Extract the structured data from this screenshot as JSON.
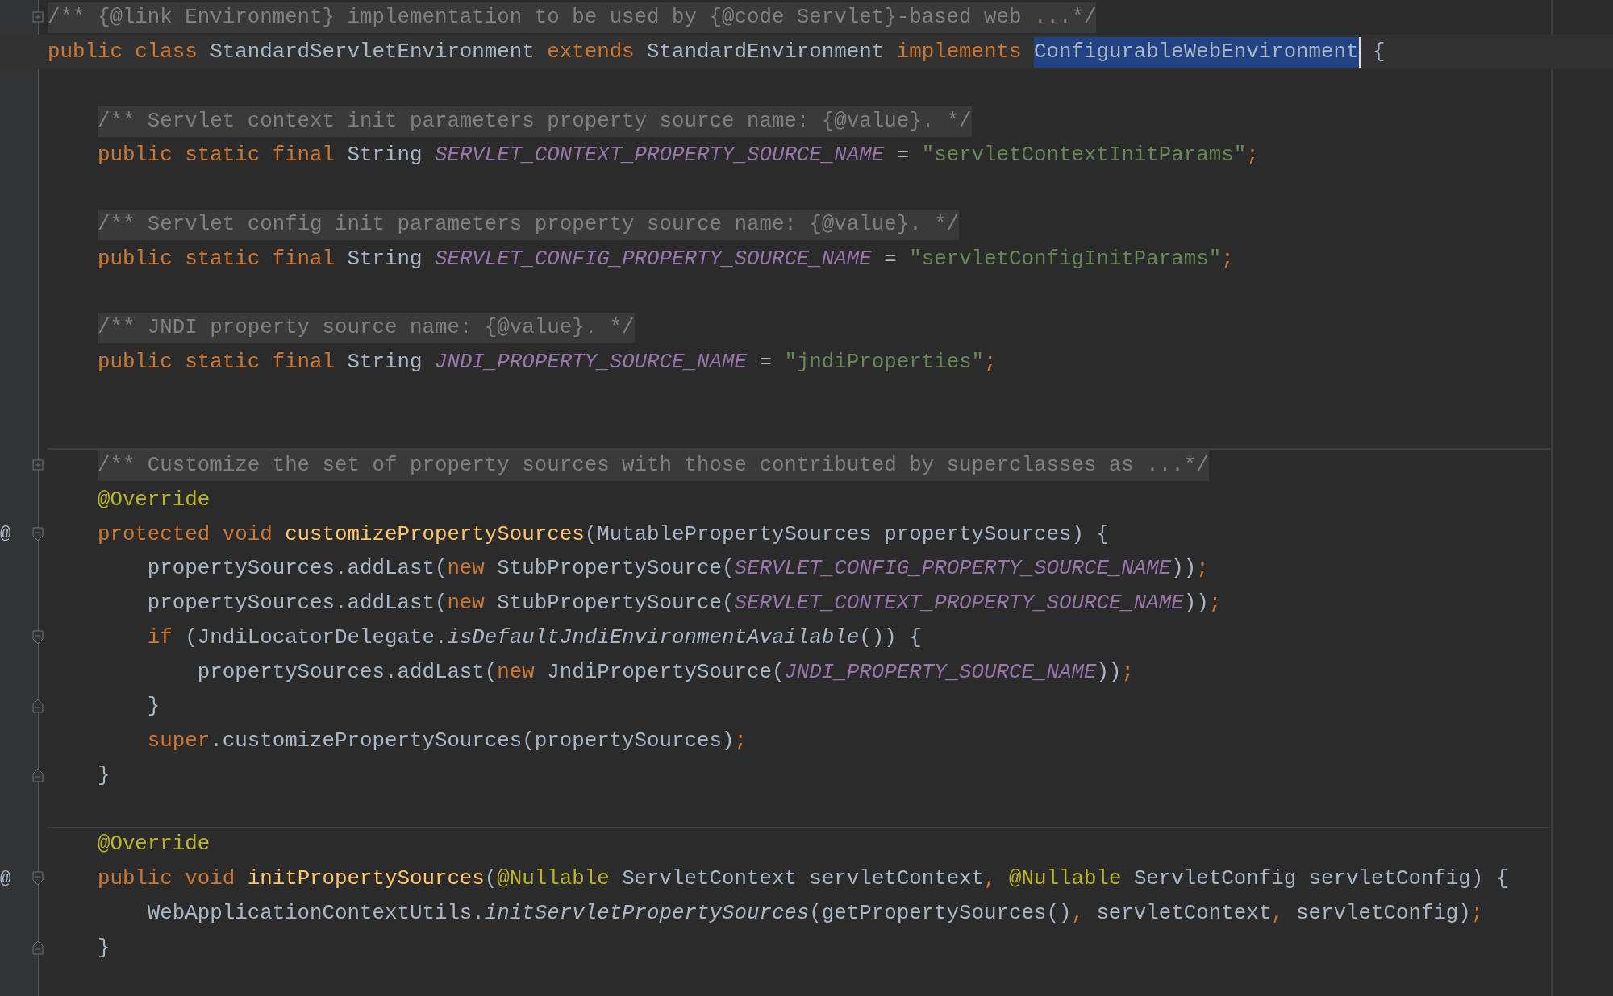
{
  "editor": {
    "lines": [
      {
        "kind": "code",
        "fold": {
          "kind": "expand"
        },
        "tokens": [
          {
            "kind": "folded-comment",
            "text": "/** {@link Environment} implementation to be used by {@code Servlet}-based web ...*/"
          }
        ]
      },
      {
        "kind": "code",
        "current": true,
        "tokens": [
          {
            "kind": "keyword",
            "text": "public class "
          },
          {
            "kind": "plain",
            "text": "StandardServletEnvironment "
          },
          {
            "kind": "keyword",
            "text": "extends "
          },
          {
            "kind": "plain",
            "text": "StandardEnvironment "
          },
          {
            "kind": "keyword",
            "text": "implements "
          },
          {
            "kind": "selected",
            "text": "ConfigurableWebEnvironment"
          },
          {
            "kind": "plain",
            "text": " {"
          }
        ]
      },
      {
        "kind": "blank"
      },
      {
        "kind": "code",
        "indented": true,
        "tokens": [
          {
            "kind": "folded-comment",
            "text": "/** Servlet context init parameters property source name: {@value}. */"
          }
        ]
      },
      {
        "kind": "code",
        "tokens": [
          {
            "kind": "keyword",
            "text": "    public static final "
          },
          {
            "kind": "plain",
            "text": "String "
          },
          {
            "kind": "constant",
            "text": "SERVLET_CONTEXT_PROPERTY_SOURCE_NAME"
          },
          {
            "kind": "plain",
            "text": " = "
          },
          {
            "kind": "string",
            "text": "\"servletContextInitParams\""
          },
          {
            "kind": "keyword",
            "text": ";"
          }
        ]
      },
      {
        "kind": "blank"
      },
      {
        "kind": "code",
        "indented": true,
        "tokens": [
          {
            "kind": "folded-comment",
            "text": "/** Servlet config init parameters property source name: {@value}. */"
          }
        ]
      },
      {
        "kind": "code",
        "tokens": [
          {
            "kind": "keyword",
            "text": "    public static final "
          },
          {
            "kind": "plain",
            "text": "String "
          },
          {
            "kind": "constant",
            "text": "SERVLET_CONFIG_PROPERTY_SOURCE_NAME"
          },
          {
            "kind": "plain",
            "text": " = "
          },
          {
            "kind": "string",
            "text": "\"servletConfigInitParams\""
          },
          {
            "kind": "keyword",
            "text": ";"
          }
        ]
      },
      {
        "kind": "blank"
      },
      {
        "kind": "code",
        "indented": true,
        "tokens": [
          {
            "kind": "folded-comment",
            "text": "/** JNDI property source name: {@value}. */"
          }
        ]
      },
      {
        "kind": "code",
        "tokens": [
          {
            "kind": "keyword",
            "text": "    public static final "
          },
          {
            "kind": "plain",
            "text": "String "
          },
          {
            "kind": "constant",
            "text": "JNDI_PROPERTY_SOURCE_NAME"
          },
          {
            "kind": "plain",
            "text": " = "
          },
          {
            "kind": "string",
            "text": "\"jndiProperties\""
          },
          {
            "kind": "keyword",
            "text": ";"
          }
        ]
      },
      {
        "kind": "blank"
      },
      {
        "kind": "blank"
      },
      {
        "kind": "code",
        "separator_above": true,
        "indented": true,
        "fold": {
          "kind": "expand"
        },
        "tokens": [
          {
            "kind": "folded-comment",
            "text": "/** Customize the set of property sources with those contributed by superclasses as ...*/"
          }
        ]
      },
      {
        "kind": "code",
        "tokens": [
          {
            "kind": "annotation",
            "text": "    @Override"
          }
        ]
      },
      {
        "kind": "code",
        "gutter_mark": "@",
        "fold": {
          "kind": "collapse-start"
        },
        "tokens": [
          {
            "kind": "keyword",
            "text": "    protected void "
          },
          {
            "kind": "method",
            "text": "customizePropertySources"
          },
          {
            "kind": "plain",
            "text": "(MutablePropertySources propertySources) {"
          }
        ]
      },
      {
        "kind": "code",
        "tokens": [
          {
            "kind": "plain",
            "text": "        propertySources.addLast("
          },
          {
            "kind": "keyword",
            "text": "new "
          },
          {
            "kind": "plain",
            "text": "StubPropertySource("
          },
          {
            "kind": "constant",
            "text": "SERVLET_CONFIG_PROPERTY_SOURCE_NAME"
          },
          {
            "kind": "plain",
            "text": "))"
          },
          {
            "kind": "keyword",
            "text": ";"
          }
        ]
      },
      {
        "kind": "code",
        "tokens": [
          {
            "kind": "plain",
            "text": "        propertySources.addLast("
          },
          {
            "kind": "keyword",
            "text": "new "
          },
          {
            "kind": "plain",
            "text": "StubPropertySource("
          },
          {
            "kind": "constant",
            "text": "SERVLET_CONTEXT_PROPERTY_SOURCE_NAME"
          },
          {
            "kind": "plain",
            "text": "))"
          },
          {
            "kind": "keyword",
            "text": ";"
          }
        ]
      },
      {
        "kind": "code",
        "fold": {
          "kind": "collapse-start"
        },
        "tokens": [
          {
            "kind": "keyword",
            "text": "        if "
          },
          {
            "kind": "plain",
            "text": "(JndiLocatorDelegate."
          },
          {
            "kind": "static-call",
            "text": "isDefaultJndiEnvironmentAvailable"
          },
          {
            "kind": "plain",
            "text": "()) {"
          }
        ]
      },
      {
        "kind": "code",
        "tokens": [
          {
            "kind": "plain",
            "text": "            propertySources.addLast("
          },
          {
            "kind": "keyword",
            "text": "new "
          },
          {
            "kind": "plain",
            "text": "JndiPropertySource("
          },
          {
            "kind": "constant",
            "text": "JNDI_PROPERTY_SOURCE_NAME"
          },
          {
            "kind": "plain",
            "text": "))"
          },
          {
            "kind": "keyword",
            "text": ";"
          }
        ]
      },
      {
        "kind": "code",
        "fold": {
          "kind": "collapse-end"
        },
        "tokens": [
          {
            "kind": "plain",
            "text": "        }"
          }
        ]
      },
      {
        "kind": "code",
        "tokens": [
          {
            "kind": "keyword",
            "text": "        super"
          },
          {
            "kind": "plain",
            "text": ".customizePropertySources(propertySources)"
          },
          {
            "kind": "keyword",
            "text": ";"
          }
        ]
      },
      {
        "kind": "code",
        "fold": {
          "kind": "collapse-end"
        },
        "tokens": [
          {
            "kind": "plain",
            "text": "    }"
          }
        ]
      },
      {
        "kind": "blank"
      },
      {
        "kind": "code",
        "separator_above": true,
        "tokens": [
          {
            "kind": "annotation",
            "text": "    @Override"
          }
        ]
      },
      {
        "kind": "code",
        "gutter_mark": "@",
        "fold": {
          "kind": "collapse-start"
        },
        "tokens": [
          {
            "kind": "keyword",
            "text": "    public void "
          },
          {
            "kind": "method",
            "text": "initPropertySources"
          },
          {
            "kind": "plain",
            "text": "("
          },
          {
            "kind": "annotation",
            "text": "@Nullable "
          },
          {
            "kind": "plain",
            "text": "ServletContext servletContext"
          },
          {
            "kind": "keyword",
            "text": ", "
          },
          {
            "kind": "annotation",
            "text": "@Nullable "
          },
          {
            "kind": "plain",
            "text": "ServletConfig servletConfig) {"
          }
        ]
      },
      {
        "kind": "code",
        "tokens": [
          {
            "kind": "plain",
            "text": "        WebApplicationContextUtils."
          },
          {
            "kind": "static-call",
            "text": "initServletPropertySources"
          },
          {
            "kind": "plain",
            "text": "(getPropertySources()"
          },
          {
            "kind": "keyword",
            "text": ", "
          },
          {
            "kind": "plain",
            "text": "servletContext"
          },
          {
            "kind": "keyword",
            "text": ", "
          },
          {
            "kind": "plain",
            "text": "servletConfig)"
          },
          {
            "kind": "keyword",
            "text": ";"
          }
        ]
      },
      {
        "kind": "code",
        "fold": {
          "kind": "collapse-end"
        },
        "tokens": [
          {
            "kind": "plain",
            "text": "    }"
          }
        ]
      }
    ]
  }
}
